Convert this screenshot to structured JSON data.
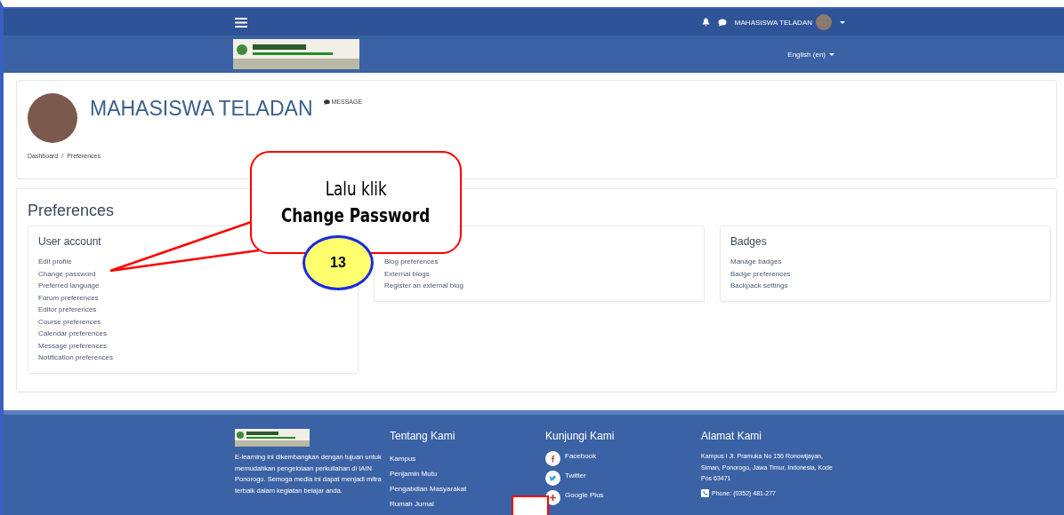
{
  "navbar": {
    "user_name": "MAHASISWA TELADAN"
  },
  "header": {
    "language": "English (en)"
  },
  "profile": {
    "name": "MAHASISWA TELADAN",
    "message_link": "MESSAGE"
  },
  "breadcrumb": {
    "separator": "/",
    "items": [
      "Dashboard",
      "Preferences"
    ]
  },
  "preferences": {
    "title": "Preferences",
    "sections": [
      {
        "title": "User account",
        "links": [
          "Edit profile",
          "Change password",
          "Preferred language",
          "Forum preferences",
          "Editor preferences",
          "Course preferences",
          "Calendar preferences",
          "Message preferences",
          "Notification preferences"
        ]
      },
      {
        "links": [
          "Blog preferences",
          "External blogs",
          "Register an external blog"
        ]
      },
      {
        "title": "Badges",
        "links": [
          "Manage badges",
          "Badge preferences",
          "Backpack settings"
        ]
      }
    ]
  },
  "callout": {
    "line_1": "Lalu klik",
    "line_2": "Change Password",
    "step": "13"
  },
  "footer": {
    "about": "E-learning ini dikembangkan dengan tujuan untuk memudahkan pengelolaan perkuliahan di IAIN Ponorogo. Semoga media ini dapat menjadi mitra terbaik dalam kegiatan belajar anda.",
    "columns": [
      {
        "title": "Tentang Kami",
        "kind": "links",
        "items": [
          "Kampus",
          "Penjamin Mutu",
          "Pengabdian Masyarakat",
          "Rumah Jurnal"
        ]
      },
      {
        "title": "Kunjungi Kami",
        "kind": "social",
        "items": [
          "Facebook",
          "Twitter",
          "Google Plus"
        ]
      },
      {
        "title": "Alamat Kami",
        "kind": "address",
        "items": [
          "Kampus I Jl. Pramuka No 156 Ronowijayan, Siman, Ponorogo, Jawa Timur, Indonesia, Kode Pos 63471",
          "Phone: (0352) 481-277"
        ]
      }
    ]
  }
}
